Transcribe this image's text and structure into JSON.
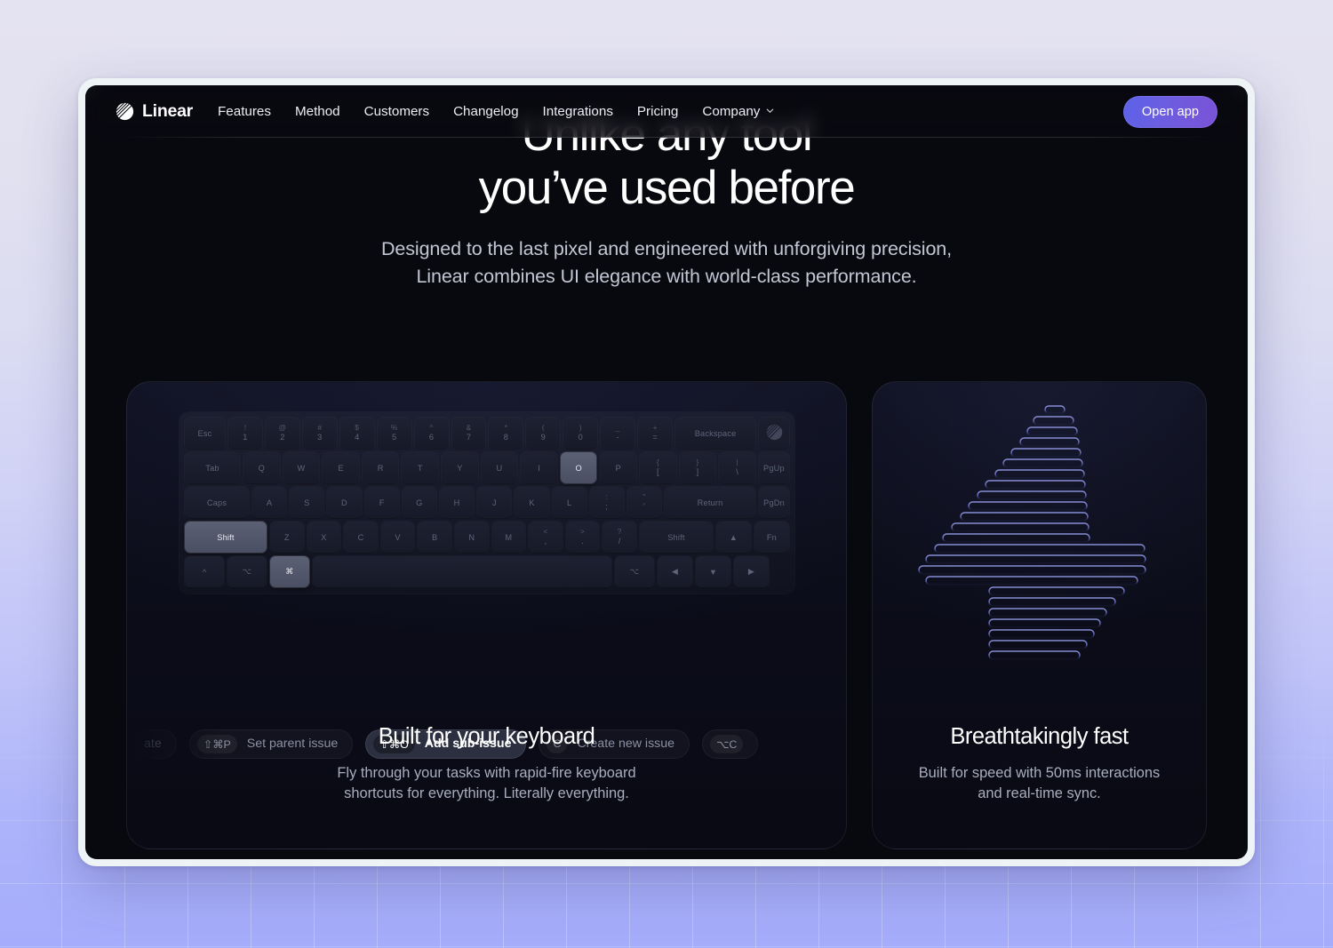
{
  "nav": {
    "brand": "Linear",
    "brand_icon": "linear-logo-icon",
    "links": [
      {
        "label": "Features"
      },
      {
        "label": "Method"
      },
      {
        "label": "Customers"
      },
      {
        "label": "Changelog"
      },
      {
        "label": "Integrations"
      },
      {
        "label": "Pricing"
      },
      {
        "label": "Company",
        "chevron": "chevron-down-icon"
      }
    ],
    "cta": {
      "label": "Open app",
      "gradient_from": "#5c62e8",
      "gradient_to": "#7a52d6"
    }
  },
  "hero": {
    "title_line_1": "Unlike any tool",
    "title_line_2": "you’ve used before",
    "subtitle": "Designed to the last pixel and engineered with unforgiving precision, Linear combines UI elegance with world-class performance."
  },
  "cards": {
    "keyboard": {
      "title": "Built for your keyboard",
      "description": "Fly through your tasks with rapid-fire keyboard shortcuts for everything. Literally everything.",
      "keyboard_rows": [
        [
          {
            "label": "Esc",
            "size": "wide-esc"
          },
          {
            "top": "!",
            "bot": "1"
          },
          {
            "top": "@",
            "bot": "2"
          },
          {
            "top": "#",
            "bot": "3"
          },
          {
            "top": "$",
            "bot": "4"
          },
          {
            "top": "%",
            "bot": "5"
          },
          {
            "top": "^",
            "bot": "6"
          },
          {
            "top": "&",
            "bot": "7"
          },
          {
            "top": "*",
            "bot": "8"
          },
          {
            "top": "(",
            "bot": "9"
          },
          {
            "top": ")",
            "bot": "0"
          },
          {
            "top": "_",
            "bot": "-"
          },
          {
            "top": "+",
            "bot": "="
          },
          {
            "label": "Backspace",
            "size": "wide-back"
          },
          {
            "label": "",
            "size": "logo-key",
            "icon": "linear-logo-icon"
          }
        ],
        [
          {
            "label": "Tab",
            "size": "wide-tab"
          },
          {
            "label": "Q"
          },
          {
            "label": "W"
          },
          {
            "label": "E"
          },
          {
            "label": "R"
          },
          {
            "label": "T"
          },
          {
            "label": "Y"
          },
          {
            "label": "U"
          },
          {
            "label": "I"
          },
          {
            "label": "O",
            "active": true
          },
          {
            "label": "P"
          },
          {
            "top": "{",
            "bot": "["
          },
          {
            "top": "}",
            "bot": "]"
          },
          {
            "top": "|",
            "bot": "\\"
          },
          {
            "label": "PgUp",
            "size": "wide-pg"
          }
        ],
        [
          {
            "label": "Caps",
            "size": "wide-caps"
          },
          {
            "label": "A"
          },
          {
            "label": "S"
          },
          {
            "label": "D"
          },
          {
            "label": "F"
          },
          {
            "label": "G"
          },
          {
            "label": "H"
          },
          {
            "label": "J"
          },
          {
            "label": "K"
          },
          {
            "label": "L"
          },
          {
            "top": ":",
            "bot": ";"
          },
          {
            "top": "\"",
            "bot": "'"
          },
          {
            "label": "Return",
            "size": "wide-ret"
          },
          {
            "label": "PgDn",
            "size": "wide-pg"
          }
        ],
        [
          {
            "label": "Shift",
            "size": "wide-shiftL",
            "active": true
          },
          {
            "label": "Z"
          },
          {
            "label": "X"
          },
          {
            "label": "C"
          },
          {
            "label": "V"
          },
          {
            "label": "B"
          },
          {
            "label": "N"
          },
          {
            "label": "M"
          },
          {
            "top": "<",
            "bot": ","
          },
          {
            "top": ">",
            "bot": "."
          },
          {
            "top": "?",
            "bot": "/"
          },
          {
            "label": "Shift",
            "size": "wide-shiftR"
          },
          {
            "label": "▲",
            "size": "wide-arrow"
          },
          {
            "label": "Fn",
            "size": "wide-arrow"
          }
        ],
        [
          {
            "label": "^",
            "size": "wide-mod"
          },
          {
            "label": "⌥",
            "size": "wide-mod"
          },
          {
            "label": "⌘",
            "size": "wide-cmd",
            "active": true
          },
          {
            "label": "",
            "size": "wide-space"
          },
          {
            "label": "⌥",
            "size": "wide-mod"
          },
          {
            "label": "◀",
            "size": "wide-arrow"
          },
          {
            "label": "▼",
            "size": "wide-arrow"
          },
          {
            "label": "▶",
            "size": "wide-arrow"
          }
        ]
      ],
      "shortcuts": [
        {
          "keys": "",
          "label": "ate",
          "partial": true
        },
        {
          "keys": "⇧⌘P",
          "label": "Set parent issue"
        },
        {
          "keys": "⇧⌘O",
          "label": "Add sub-issue",
          "active": true
        },
        {
          "keys": "C",
          "label": "Create new issue"
        },
        {
          "keys": "⌥C",
          "label": "",
          "partial": true
        }
      ]
    },
    "fast": {
      "title": "Breathtakingly fast",
      "description": "Built for speed with 50ms interactions and real-time sync.",
      "graphic": "number-four-speed-lines",
      "graphic_stroke": "#6f76c4"
    }
  },
  "theme": {
    "page_background_top": "#e4e3f1",
    "page_background_bottom": "#a5acfb",
    "browser_frame": "#eef3f6",
    "viewport_background": "#08090f",
    "card_background": "#0b0c18",
    "accent": "#6d5de0"
  }
}
